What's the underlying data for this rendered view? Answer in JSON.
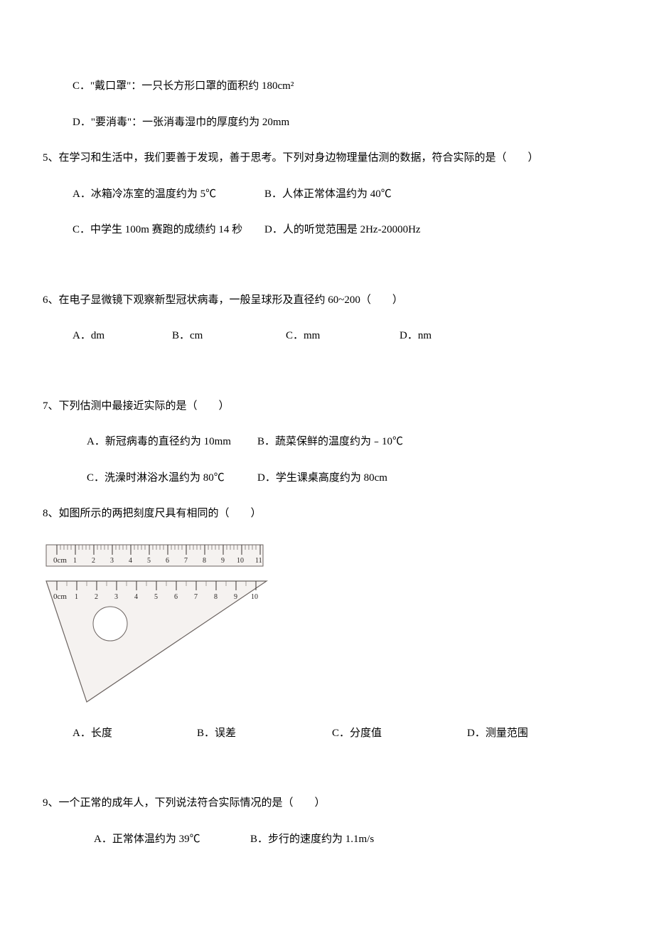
{
  "q4": {
    "optC": "C．\"戴口罩\"：一只长方形口罩的面积约 180cm²",
    "optD": "D．\"要消毒\"：一张消毒湿巾的厚度约为 20mm"
  },
  "q5": {
    "stem": "5、在学习和生活中，我们要善于发现，善于思考。下列对身边物理量估测的数据，符合实际的是（　　）",
    "optA": "A．冰箱冷冻室的温度约为 5℃",
    "optB": "B．人体正常体温约为 40℃",
    "optC": "C．中学生 100m 赛跑的成绩约 14 秒",
    "optD": "D．人的听觉范围是 2Hz-20000Hz"
  },
  "q6": {
    "stem": "6、在电子显微镜下观察新型冠状病毒，一般呈球形及直径约 60~200（　　）",
    "optA": "A．dm",
    "optB": "B．cm",
    "optC": "C．mm",
    "optD": "D．nm"
  },
  "q7": {
    "stem": "7、下列估测中最接近实际的是（　　）",
    "optA": "A．新冠病毒的直径约为 10mm",
    "optB": "B．蔬菜保鲜的温度约为﹣10℃",
    "optC": "C．洗澡时淋浴水温约为 80℃",
    "optD": "D．学生课桌高度约为 80cm"
  },
  "q8": {
    "stem": "8、如图所示的两把刻度尺具有相同的（　　）",
    "optA": "A．长度",
    "optB": "B．误差",
    "optC": "C．分度值",
    "optD": "D．测量范围"
  },
  "q9": {
    "stem": "9、一个正常的成年人，下列说法符合实际情况的是（　　）",
    "optA": "A．正常体温约为 39℃",
    "optB": "B．步行的速度约为 1.1m/s"
  },
  "ruler": {
    "top": {
      "unit": "0cm",
      "ticks": [
        "1",
        "2",
        "3",
        "4",
        "5",
        "6",
        "7",
        "8",
        "9",
        "10",
        "11"
      ]
    },
    "bottom": {
      "unit": "0cm",
      "ticks": [
        "1",
        "2",
        "3",
        "4",
        "5",
        "6",
        "7",
        "8",
        "9",
        "10"
      ]
    }
  }
}
